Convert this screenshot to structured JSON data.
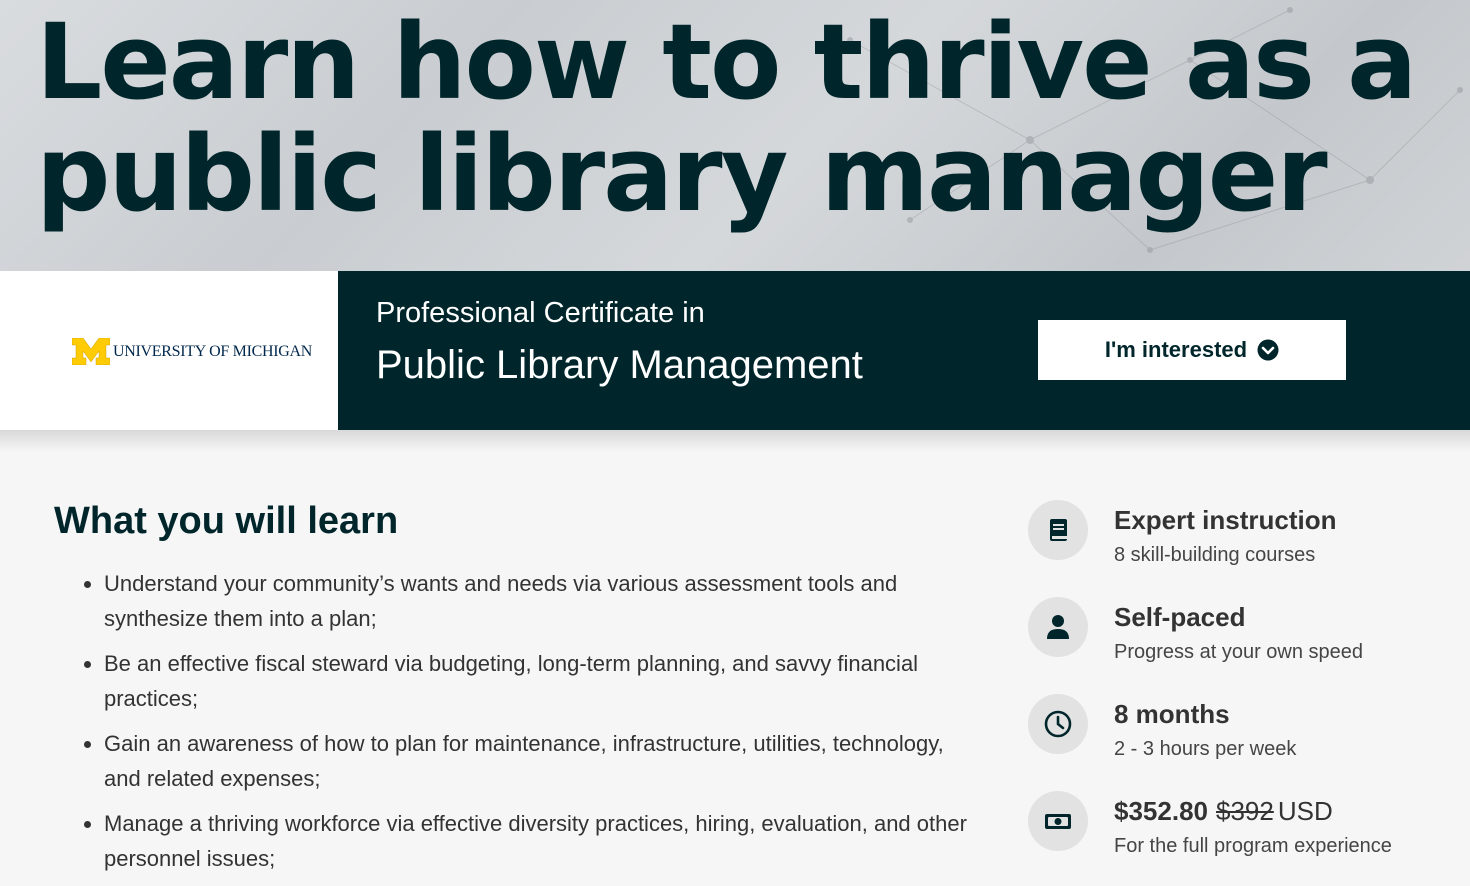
{
  "hero": {
    "title_line1": "Learn how to thrive as a",
    "title_line2": "public library manager"
  },
  "banner": {
    "logo_text": "UNIVERSITY OF MICHIGAN",
    "cert_prefix": "Professional Certificate in",
    "cert_name": "Public Library Management",
    "interest_button": "I'm interested"
  },
  "learn": {
    "title": "What you will learn",
    "items": [
      "Understand your community’s wants and needs via various assessment tools and synthesize them into a plan;",
      "Be an effective fiscal steward via budgeting, long-term planning, and savvy financial practices;",
      "Gain an awareness of how to plan for maintenance, infrastructure, utilities, technology, and related expenses;",
      "Manage a thriving workforce via effective diversity practices, hiring, evaluation, and other personnel issues;"
    ]
  },
  "features": [
    {
      "icon": "book-icon",
      "title": "Expert instruction",
      "sub": "8 skill-building courses"
    },
    {
      "icon": "person-icon",
      "title": "Self-paced",
      "sub": "Progress at your own speed"
    },
    {
      "icon": "clock-icon",
      "title": "8 months",
      "sub": "2 - 3 hours per week"
    },
    {
      "icon": "money-icon",
      "price": "$352.80",
      "old_price": "$392",
      "currency": "USD",
      "sub": "For the full program experience"
    }
  ],
  "colors": {
    "dark_teal": "#00262b",
    "michigan_maize": "#ffcb05",
    "michigan_blue": "#00274c"
  }
}
